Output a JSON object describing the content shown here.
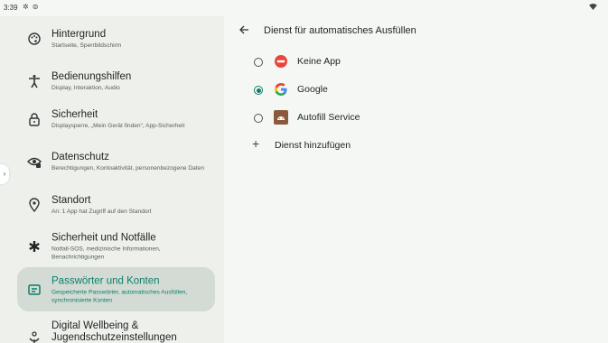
{
  "status": {
    "time": "3:39"
  },
  "sidebar": {
    "items": [
      {
        "name": "hintergrund",
        "title": "Hintergrund",
        "subtitle": "Startseite, Sperrbildschirm"
      },
      {
        "name": "bedienungshilfen",
        "title": "Bedienungshilfen",
        "subtitle": "Display, Interaktion, Audio"
      },
      {
        "name": "sicherheit",
        "title": "Sicherheit",
        "subtitle": "Displaysperre, „Mein Gerät finden“, App-Sicherheit"
      },
      {
        "name": "datenschutz",
        "title": "Datenschutz",
        "subtitle": "Berechtigungen, Kontoaktivität, personenbezogene Daten"
      },
      {
        "name": "standort",
        "title": "Standort",
        "subtitle": "An: 1 App hat Zugriff auf den Standort"
      },
      {
        "name": "notfall",
        "title": "Sicherheit und Notfälle",
        "subtitle": "Notfall-SOS, medizinische Informationen, Benachrichtigungen"
      },
      {
        "name": "passwoerter",
        "title": "Passwörter und Konten",
        "subtitle": "Gespeicherte Passwörter, automatisches Ausfüllen, synchronisierte Konten",
        "selected": true
      },
      {
        "name": "wellbeing",
        "title": "Digital Wellbeing & Jugendschutzeinstellungen",
        "subtitle": ""
      }
    ]
  },
  "main": {
    "title": "Dienst für automatisches Ausfüllen",
    "options": [
      {
        "label": "Keine App",
        "checked": false,
        "icon": "no-entry-icon"
      },
      {
        "label": "Google",
        "checked": true,
        "icon": "google-icon"
      },
      {
        "label": "Autofill Service",
        "checked": false,
        "icon": "android-icon"
      }
    ],
    "add_label": "Dienst hinzufügen"
  },
  "colors": {
    "accent": "#0b7f6a",
    "selected_bg": "#d3dbd4",
    "sidebar_bg": "#edf0eb",
    "main_bg": "#f4f7f3"
  }
}
